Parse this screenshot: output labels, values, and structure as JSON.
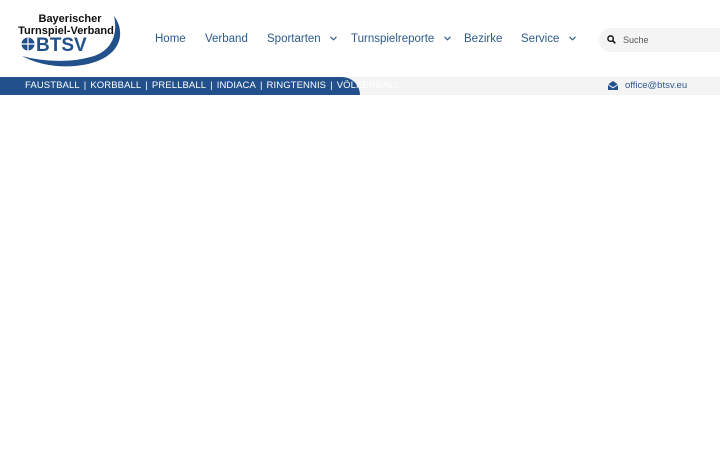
{
  "logo": {
    "line1": "Bayerischer",
    "line2": "Turnspiel-Verband",
    "acronym": "BTSV"
  },
  "nav": {
    "items": [
      {
        "label": "Home",
        "has_dropdown": false
      },
      {
        "label": "Verband",
        "has_dropdown": false
      },
      {
        "label": "Sportarten",
        "has_dropdown": true
      },
      {
        "label": "Turnspielreporte",
        "has_dropdown": true
      },
      {
        "label": "Bezirke",
        "has_dropdown": false
      },
      {
        "label": "Service",
        "has_dropdown": true
      }
    ]
  },
  "search": {
    "placeholder": "Suche"
  },
  "sports_bar": {
    "items": [
      "FAUSTBALL",
      "KORBBALL",
      "PRELLBALL",
      "INDIACA",
      "RINGTENNIS",
      "VÖLKERBALL"
    ],
    "separator": "|"
  },
  "contact": {
    "email": "office@btsv.eu",
    "icon": "mail-open-icon"
  },
  "colors": {
    "brand_blue": "#22508a",
    "nav_text": "#2c5a8c",
    "subbar_bg": "#f4f4f4",
    "search_bg": "#f4f4f4"
  }
}
